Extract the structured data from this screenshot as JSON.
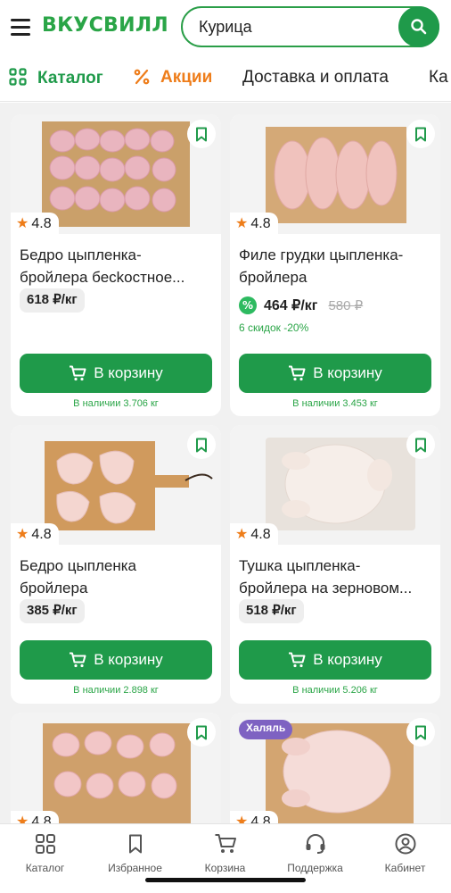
{
  "header": {
    "logo": "ВКУСВИЛЛ",
    "search_value": "Курица"
  },
  "nav": {
    "items": [
      {
        "label": "Каталог",
        "icon": "grid-icon"
      },
      {
        "label": "Акции",
        "icon": "percent-icon"
      },
      {
        "label": "Доставка и оплата"
      },
      {
        "label": "Ка"
      }
    ]
  },
  "products": [
    {
      "rating": "4.8",
      "title_l1": "Бедро цыпленка-",
      "title_l2": "бройлера бесkостное...",
      "price": "618 ₽/кг",
      "button": "В корзину",
      "stock": "В наличии 3.706 кг"
    },
    {
      "rating": "4.8",
      "title_l1": "Филе грудки цыпленка-",
      "title_l2": "бройлера",
      "price": "464 ₽/кг",
      "old_price": "580 ₽",
      "discount_icon": "%",
      "discount_note": "6 скидок -20%",
      "button": "В корзину",
      "stock": "В наличии 3.453 кг"
    },
    {
      "rating": "4.8",
      "title_l1": "Бедро цыпленка",
      "title_l2": "бройлера",
      "price": "385 ₽/кг",
      "button": "В корзину",
      "stock": "В наличии 2.898 кг"
    },
    {
      "rating": "4.8",
      "title_l1": "Тушка цыпленка-",
      "title_l2": "бройлера на зерновом...",
      "price": "518 ₽/кг",
      "button": "В корзину",
      "stock": "В наличии 5.206 кг"
    },
    {
      "rating": "4.8"
    },
    {
      "rating": "4.8",
      "badge": "Халяль"
    }
  ],
  "bottom_nav": [
    {
      "label": "Каталог",
      "icon": "grid-icon"
    },
    {
      "label": "Избранное",
      "icon": "bookmark-icon"
    },
    {
      "label": "Корзина",
      "icon": "cart-icon"
    },
    {
      "label": "Поддержка",
      "icon": "headset-icon"
    },
    {
      "label": "Кабинет",
      "icon": "user-icon"
    }
  ],
  "colors": {
    "brand_green": "#1f9a4a",
    "sale_orange": "#ee7d1a",
    "halal_purple": "#7e62c2"
  }
}
